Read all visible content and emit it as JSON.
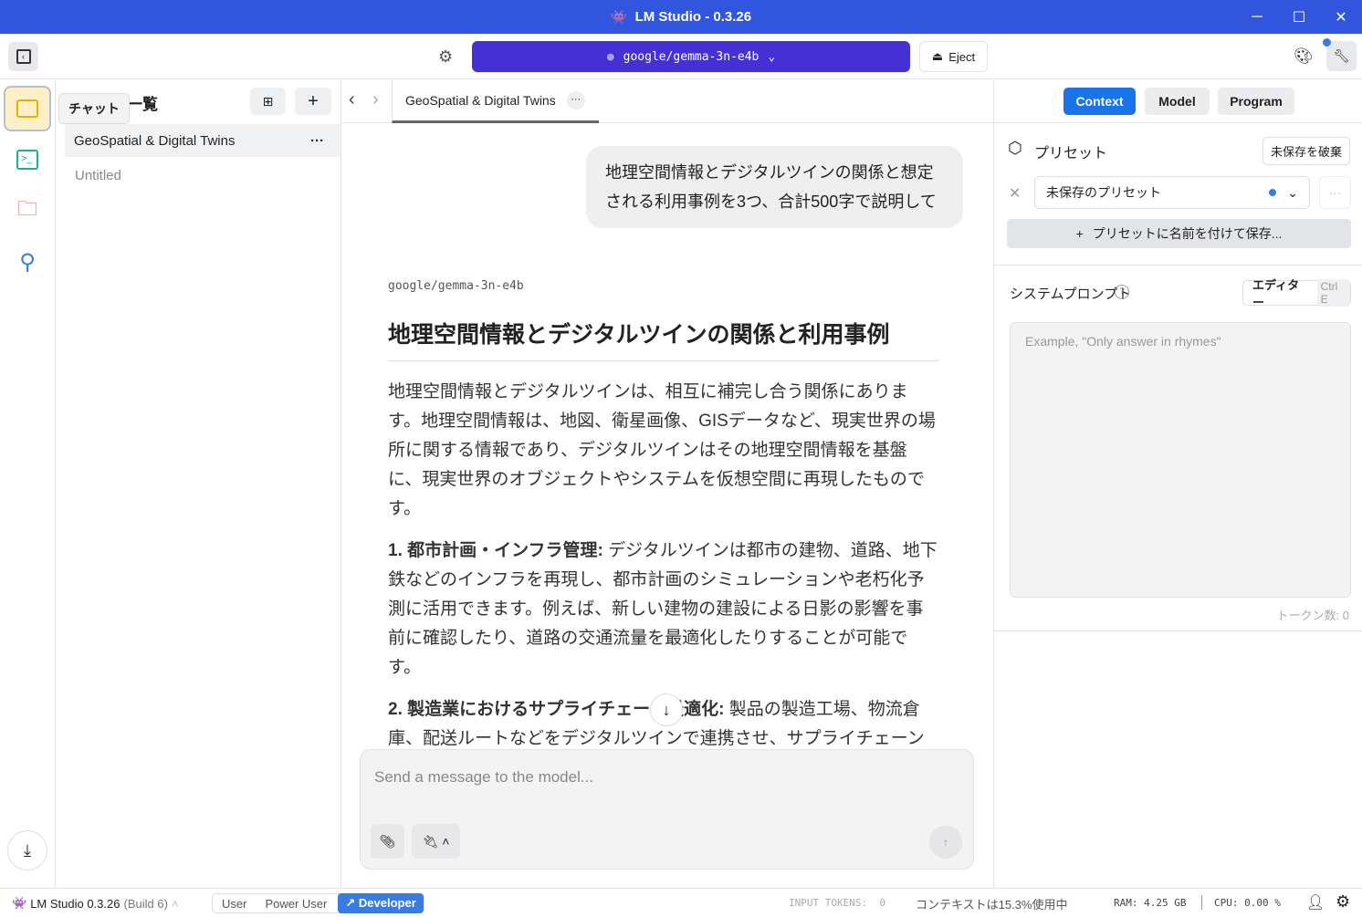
{
  "window": {
    "title": "LM Studio - 0.3.26"
  },
  "toolbar": {
    "model": "google/gemma-3n-e4b",
    "eject": "Eject"
  },
  "rail": {
    "tooltip": "チャット"
  },
  "sidebar": {
    "title": "一覧",
    "chats": [
      {
        "label": "GeoSpatial & Digital Twins"
      },
      {
        "label": "Untitled"
      }
    ]
  },
  "main": {
    "tab": "GeoSpatial & Digital Twins",
    "user_message": "地理空間情報とデジタルツインの関係と想定される利用事例を3つ、合計500字で説明して",
    "model_name": "google/gemma-3n-e4b",
    "heading": "地理空間情報とデジタルツインの関係と利用事例",
    "intro": "地理空間情報とデジタルツインは、相互に補完し合う関係にあります。地理空間情報は、地図、衛星画像、GISデータなど、現実世界の場所に関する情報であり、デジタルツインはその地理空間情報を基盤に、現実世界のオブジェクトやシステムを仮想空間に再現したものです。",
    "items": [
      {
        "title": "1. 都市計画・インフラ管理:",
        "body": " デジタルツインは都市の建物、道路、地下鉄などのインフラを再現し、都市計画のシミュレーションや老朽化予測に活用できます。例えば、新しい建物の建設による日影の影響を事前に確認したり、道路の交通流量を最適化したりすることが可能です。"
      },
      {
        "title": "2. 製造業におけるサプライチェーン最適化:",
        "body": " 製品の製造工場、物流倉庫、配送ルートなどをデジタルツインで連携させ、サプライチェーン全体を可視化・最適化できます。リアルタイムな在庫状況や輸送状況の把握、ボトルネックの早期"
      }
    ],
    "input_placeholder": "Send a message to the model..."
  },
  "right": {
    "tabs": [
      "Context",
      "Model",
      "Program"
    ],
    "preset_label": "プリセット",
    "discard": "未保存を破棄",
    "preset_value": "未保存のプリセット",
    "save_preset": "プリセットに名前を付けて保存...",
    "system_prompt": "システムプロンプト",
    "editor": "エディター",
    "shortcut": "Ctrl E",
    "prompt_placeholder": "Example, \"Only answer in rhymes\"",
    "tokens": "トークン数: 0"
  },
  "status": {
    "app": "LM Studio 0.3.26",
    "build": "(Build 6)",
    "modes": [
      "User",
      "Power User",
      "Developer"
    ],
    "input_tokens": "INPUT TOKENS:  0",
    "context": "コンテキストは15.3%使用中",
    "ram": "RAM: 4.25 GB",
    "cpu": "CPU: 0.00 %"
  },
  "colors": {
    "titlebar": "#3156dd",
    "model": "#4430d4",
    "accent": "#1a73e8"
  }
}
